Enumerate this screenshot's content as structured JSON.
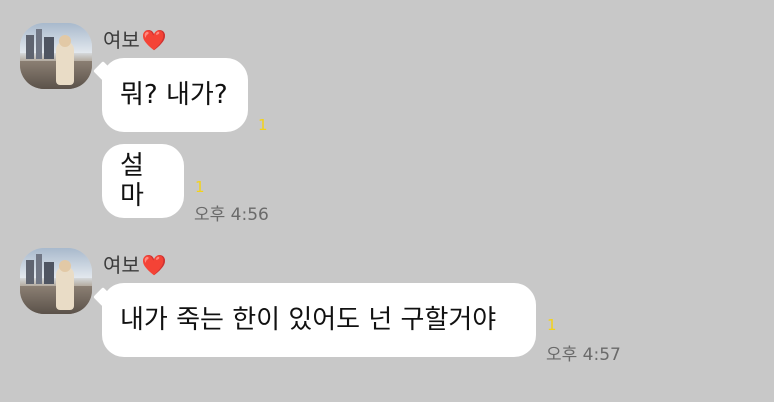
{
  "chat": {
    "messages": [
      {
        "sender": "여보",
        "sender_emoji": "❤️",
        "avatar_icon": "profile-photo-icon",
        "bubbles": [
          {
            "text": "뭐? 내가?",
            "unread": "1",
            "time": ""
          },
          {
            "text": "설마",
            "unread": "1",
            "time": "오후 4:56"
          }
        ]
      },
      {
        "sender": "여보",
        "sender_emoji": "❤️",
        "avatar_icon": "profile-photo-icon",
        "bubbles": [
          {
            "text": "내가 죽는 한이 있어도 넌 구할거야",
            "unread": "1",
            "time": "오후 4:57"
          }
        ]
      }
    ]
  },
  "colors": {
    "background": "#c8c8c8",
    "bubble": "#ffffff",
    "unread": "#f3d21a",
    "heart": "#e0202a"
  }
}
